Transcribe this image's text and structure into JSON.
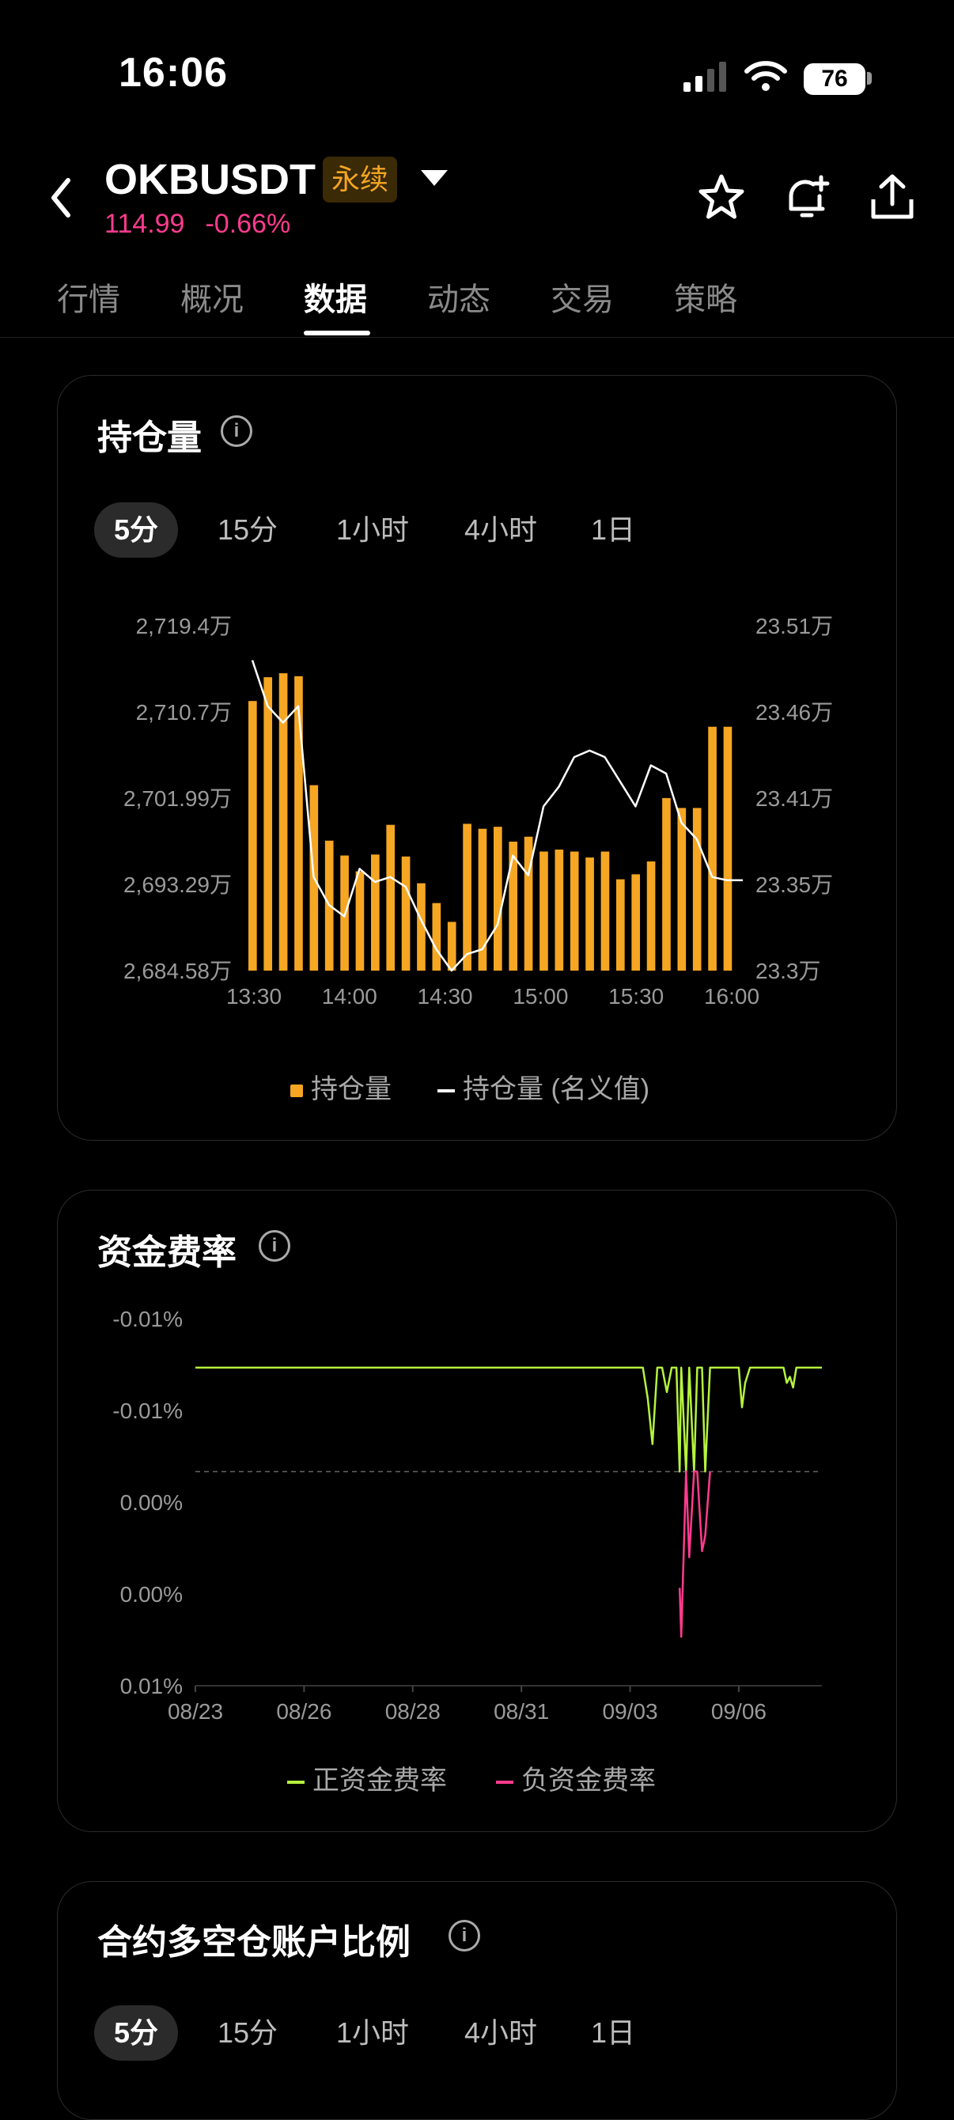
{
  "status_bar": {
    "time": "16:06",
    "battery": "76"
  },
  "header": {
    "symbol": "OKBUSDT",
    "contract_badge": "永续",
    "price": "114.99",
    "change": "-0.66%"
  },
  "tabs": [
    {
      "label": "行情",
      "active": false
    },
    {
      "label": "概况",
      "active": false
    },
    {
      "label": "数据",
      "active": true
    },
    {
      "label": "动态",
      "active": false
    },
    {
      "label": "交易",
      "active": false
    },
    {
      "label": "策略",
      "active": false
    }
  ],
  "open_interest": {
    "title": "持仓量",
    "intervals": [
      {
        "label": "5分",
        "active": true
      },
      {
        "label": "15分",
        "active": false
      },
      {
        "label": "1小时",
        "active": false
      },
      {
        "label": "4小时",
        "active": false
      },
      {
        "label": "1日",
        "active": false
      }
    ],
    "legend": {
      "bars": "持仓量",
      "line": "持仓量 (名义值)"
    }
  },
  "funding_rate": {
    "title": "资金费率",
    "legend": {
      "positive": "正资金费率",
      "negative": "负资金费率"
    }
  },
  "long_short": {
    "title": "合约多空仓账户比例",
    "intervals": [
      {
        "label": "5分",
        "active": true
      },
      {
        "label": "15分",
        "active": false
      },
      {
        "label": "1小时",
        "active": false
      },
      {
        "label": "4小时",
        "active": false
      },
      {
        "label": "1日",
        "active": false
      }
    ]
  },
  "colors": {
    "accent": "#f5a623",
    "negative": "#ff3b8e",
    "positive_rate": "#b5f23d",
    "line": "#ffffff"
  },
  "chart_data": [
    {
      "type": "bar",
      "name": "open_interest",
      "x_ticks": [
        "13:30",
        "14:00",
        "14:30",
        "15:00",
        "15:30",
        "16:00"
      ],
      "y_left_ticks": [
        "2,684.58万",
        "2,693.29万",
        "2,701.99万",
        "2,710.7万",
        "2,719.4万"
      ],
      "y_right_ticks": [
        "23.3万",
        "23.35万",
        "23.41万",
        "23.46万",
        "23.51万"
      ],
      "ylim_left": [
        2684.58,
        2719.4
      ],
      "ylim_right": [
        23.3,
        23.51
      ],
      "series": [
        {
          "name": "持仓量",
          "axis": "left",
          "color": "#f5a623",
          "values": [
            2711.8,
            2714.2,
            2714.6,
            2714.3,
            2703.3,
            2697.7,
            2696.2,
            2694.6,
            2696.3,
            2699.3,
            2696.1,
            2693.4,
            2691.4,
            2689.5,
            2699.4,
            2698.9,
            2699.1,
            2697.6,
            2698.1,
            2696.6,
            2696.8,
            2696.6,
            2696.0,
            2696.6,
            2693.8,
            2694.3,
            2695.6,
            2702.0,
            2701.0,
            2701.0,
            2709.2,
            2709.2
          ]
        },
        {
          "name": "持仓量 (名义值)",
          "axis": "right",
          "color": "#ffffff",
          "values": [
            23.489,
            23.461,
            23.451,
            23.461,
            23.357,
            23.34,
            23.333,
            23.362,
            23.354,
            23.357,
            23.351,
            23.331,
            23.313,
            23.3,
            23.31,
            23.313,
            23.328,
            23.37,
            23.358,
            23.4,
            23.412,
            23.43,
            23.434,
            23.43,
            23.415,
            23.4,
            23.425,
            23.42,
            23.39,
            23.38,
            23.357,
            23.355,
            23.355
          ]
        }
      ]
    },
    {
      "type": "line",
      "name": "funding_rate",
      "x_ticks": [
        "08/23",
        "08/26",
        "08/28",
        "08/31",
        "09/03",
        "09/06"
      ],
      "y_ticks": [
        "0.01%",
        "0.00%",
        "0.00%",
        "-0.01%",
        "-0.01%"
      ],
      "ylim": [
        -0.014,
        0.01
      ],
      "series": [
        {
          "name": "正资金费率",
          "color": "#b5f23d",
          "x": [
            0,
            14.0,
            14.15,
            14.3,
            14.45,
            14.6,
            14.75,
            14.9,
            15.05,
            15.15,
            15.2,
            15.35,
            15.45,
            15.6,
            15.7,
            15.85,
            15.95,
            16.1,
            16.25,
            16.35,
            16.45,
            17.0,
            17.1,
            17.2,
            17.35,
            18.4,
            18.5,
            18.6,
            18.7,
            18.8,
            19.6
          ],
          "y": [
            0.0068,
            0.0068,
            0.0048,
            0.0018,
            0.0068,
            0.0068,
            0.0052,
            0.0068,
            0.0068,
            0.0,
            0.0068,
            0.0,
            0.0068,
            0.0,
            0.0068,
            0.0068,
            0.0,
            0.0068,
            0.0068,
            0.0068,
            0.0068,
            0.0068,
            0.0042,
            0.0058,
            0.0068,
            0.0068,
            0.0058,
            0.0062,
            0.0055,
            0.0068,
            0.0068
          ]
        },
        {
          "name": "负资金费率",
          "color": "#ff3b8e",
          "x": [
            15.15,
            15.2,
            15.35,
            15.45,
            15.6,
            15.7,
            15.85,
            15.95,
            16.1
          ],
          "y": [
            -0.0076,
            -0.0108,
            0.0,
            -0.0056,
            0.0,
            0.0,
            -0.0052,
            -0.0042,
            0.0
          ]
        }
      ]
    }
  ]
}
